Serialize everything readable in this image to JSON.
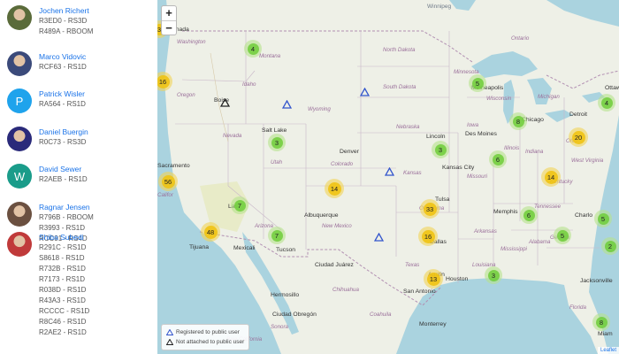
{
  "users": [
    {
      "name": "Jochen Richert",
      "avatar": "photo",
      "color": "#5a6b3a",
      "lines": [
        "R3ED0 - RS3D",
        "R489A - RBOOM"
      ]
    },
    {
      "name": "Marco Vidovic",
      "avatar": "photo",
      "color": "#3b4a7a",
      "lines": [
        "RCF63 - RS1D"
      ]
    },
    {
      "name": "Patrick Wisler",
      "avatar": "letter",
      "letter": "P",
      "color": "#1fa3ec",
      "lines": [
        "RA564 - RS1D"
      ]
    },
    {
      "name": "Daniel Buergin",
      "avatar": "photo",
      "color": "#2a2a7a",
      "lines": [
        "R0C73 - RS3D"
      ]
    },
    {
      "name": "David Sewer",
      "avatar": "letter",
      "letter": "W",
      "color": "#1a9c8a",
      "lines": [
        "R2AEB - RS1D"
      ]
    },
    {
      "name": "Ragnar Jensen",
      "avatar": "photo",
      "color": "#6b5040",
      "lines": [
        "R796B - RBOOM",
        "R3993 - RS1D",
        "RCC91 - RS4D"
      ]
    },
    {
      "name": "Shiba Subedi",
      "avatar": "photo",
      "color": "#c03a3a",
      "lines": [
        "R291C - RS1D",
        "S8618 - RS1D",
        "R732B - RS1D",
        "R7173 - RS1D",
        "R038D - RS1D",
        "R43A3 - RS1D",
        "RCCCC - RS1D",
        "R8C46 - RS1D",
        "R2AE2 - RS1D"
      ]
    }
  ],
  "map": {
    "zoom_in": "+",
    "zoom_out": "−",
    "attribution": "Leaflet",
    "legend": {
      "registered": "Registered to public user",
      "not_attached": "Not attached to public user"
    },
    "clusters": [
      {
        "count": "3",
        "color": "yellow"
      },
      {
        "count": "4",
        "color": "green"
      },
      {
        "count": "16",
        "color": "yellow"
      },
      {
        "count": "5",
        "color": "green"
      },
      {
        "count": "4",
        "color": "green"
      },
      {
        "count": "8",
        "color": "green"
      },
      {
        "count": "20",
        "color": "yellow"
      },
      {
        "count": "3",
        "color": "green"
      },
      {
        "count": "3",
        "color": "green"
      },
      {
        "count": "6",
        "color": "green"
      },
      {
        "count": "56",
        "color": "yellow"
      },
      {
        "count": "14",
        "color": "yellow"
      },
      {
        "count": "14",
        "color": "yellow"
      },
      {
        "count": "7",
        "color": "green"
      },
      {
        "count": "33",
        "color": "yellow"
      },
      {
        "count": "6",
        "color": "green"
      },
      {
        "count": "5",
        "color": "green"
      },
      {
        "count": "48",
        "color": "yellow"
      },
      {
        "count": "7",
        "color": "green"
      },
      {
        "count": "16",
        "color": "yellow"
      },
      {
        "count": "5",
        "color": "green"
      },
      {
        "count": "2",
        "color": "green"
      },
      {
        "count": "13",
        "color": "yellow"
      },
      {
        "count": "3",
        "color": "green"
      },
      {
        "count": "8",
        "color": "green"
      }
    ],
    "labels": {
      "winnipeg": "Winnipeg",
      "washington": "Washington",
      "montana": "Montana",
      "north_dakota": "North Dakota",
      "minnesota": "Minnesota",
      "ontario": "Ontario",
      "oregon": "Oregon",
      "idaho": "Idaho",
      "boise": "Boise",
      "south_dakota": "South Dakota",
      "wyoming": "Wyoming",
      "wisconsin": "Wisconsin",
      "michigan": "Michigan",
      "minneapolis": "Minneapolis",
      "chicago": "Chicago",
      "detroit": "Detroit",
      "ottawa": "Ottaw",
      "salt_lake": "Salt Lake",
      "iowa": "Iowa",
      "des_moines": "Des Moines",
      "lincoln": "Lincoln",
      "nebraska": "Nebraska",
      "nevada": "Nevada",
      "utah": "Utah",
      "denver": "Denver",
      "illinois": "Illinois",
      "indiana": "Indiana",
      "ohio": "Ohio",
      "colorado": "Colorado",
      "kansas": "Kansas",
      "kansas_city": "Kansas City",
      "sacramento": "Sacramento",
      "california": "Califor",
      "missouri": "Missouri",
      "west_virginia": "West Virginia",
      "kentucky": "Kentucky",
      "las_vegas": "Las",
      "arizona": "Arizona",
      "oklahoma": "Oklahoma",
      "tulsa": "Tulsa",
      "tennessee": "Tennessee",
      "memphis": "Memphis",
      "charlotte": "Charlo",
      "albuquerque": "Albuquerque",
      "new_mexico": "New Mexico",
      "arkansas": "Arkansas",
      "georgia": "Georgia",
      "mississippi": "Mississippi",
      "alabama": "Alabama",
      "tijuana": "Tijuana",
      "mexicali": "Mexicali",
      "tucson": "Tucson",
      "dallas": "Dallas",
      "ciudad_juarez": "Ciudad Juárez",
      "texas": "Texas",
      "louisiana": "Louisiana",
      "jacksonville": "Jacksonville",
      "austin": "Austin",
      "houston": "Houston",
      "hermosillo": "Hermosillo",
      "chihuahua": "Chihuahua",
      "san_antonio": "San Antonio",
      "florida": "Florida",
      "ciudad_obregon": "Ciudad Obregón",
      "coahuila": "Coahuila",
      "sonora": "Sonora",
      "baja_california": "Baja California",
      "monterrey": "Monterrey",
      "miami": "Miam",
      "canada": "Canada"
    }
  }
}
